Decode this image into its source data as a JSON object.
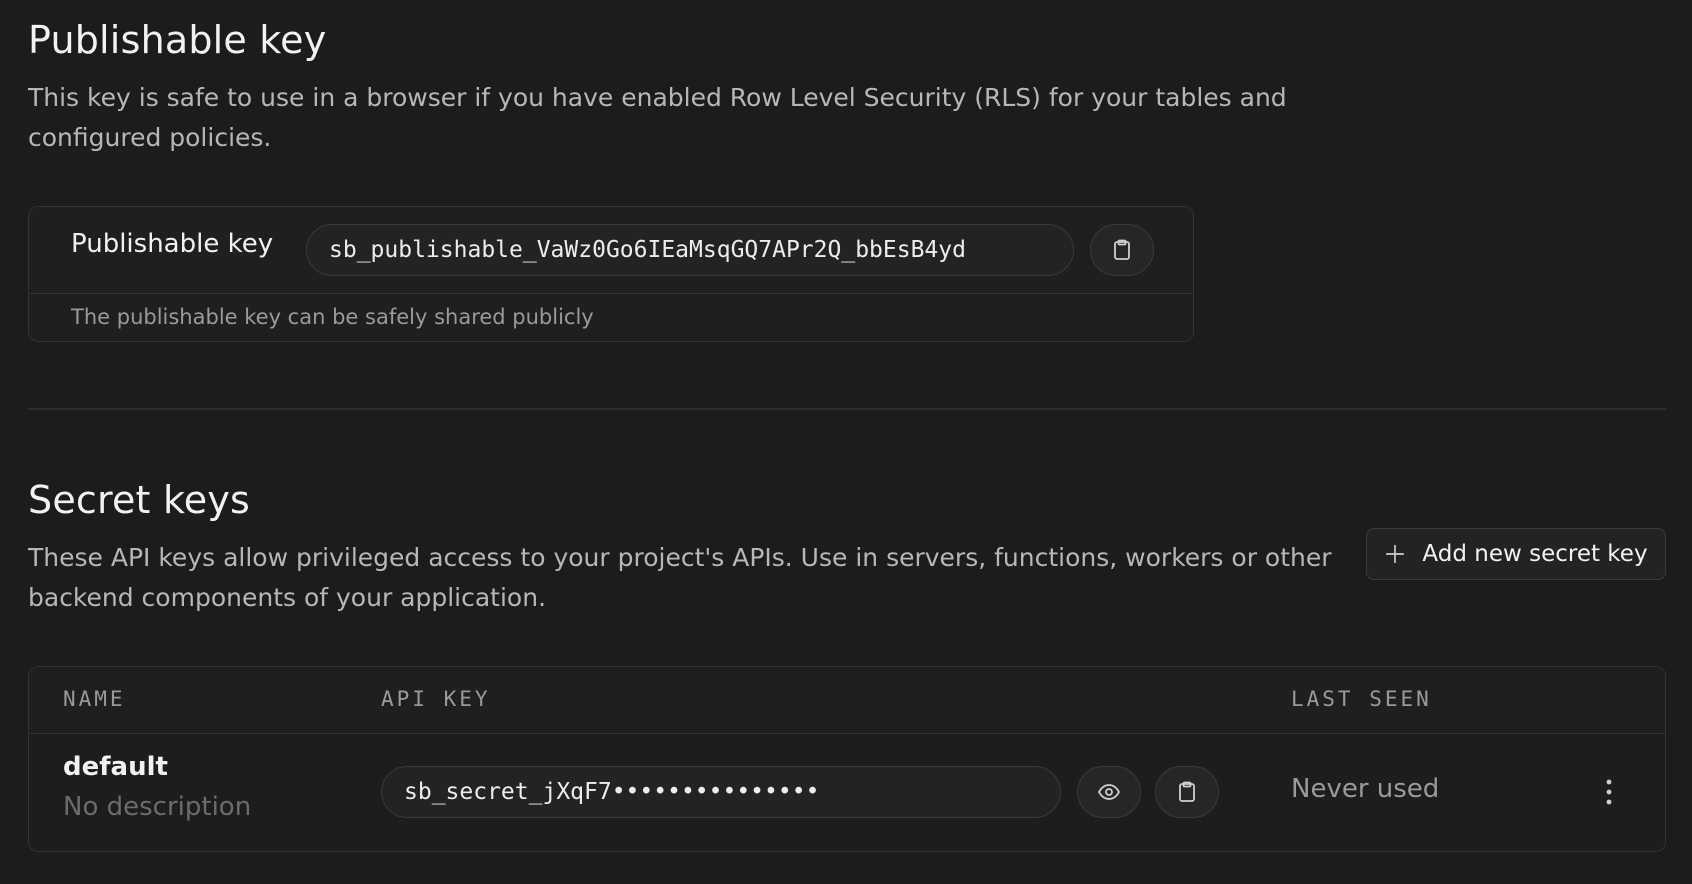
{
  "publishable": {
    "title": "Publishable key",
    "description": "This key is safe to use in a browser if you have enabled Row Level Security (RLS) for your tables and configured policies.",
    "field_label": "Publishable key",
    "key_value": "sb_publishable_VaWz0Go6IEaMsqGQ7APr2Q_bbEsB4yd",
    "note": "The publishable key can be safely shared publicly",
    "copy_icon": "clipboard-icon"
  },
  "secret": {
    "title": "Secret keys",
    "description": "These API keys allow privileged access to your project's APIs. Use in servers, functions, workers or other backend components of your application.",
    "add_button_label": "Add new secret key",
    "add_icon": "plus-icon",
    "table": {
      "columns": [
        "NAME",
        "API KEY",
        "LAST SEEN"
      ],
      "rows": [
        {
          "name": "default",
          "description": "No description",
          "api_key": "sb_secret_jXqF7•••••••••••••••",
          "last_seen": "Never used",
          "reveal_icon": "eye-icon",
          "copy_icon": "clipboard-icon",
          "menu_icon": "more-vertical-icon"
        }
      ]
    }
  },
  "colors": {
    "background": "#1c1c1c",
    "card": "#1f1f1f",
    "border": "#333333",
    "text_primary": "#f2f2f2",
    "text_secondary": "#9a9a9a"
  }
}
